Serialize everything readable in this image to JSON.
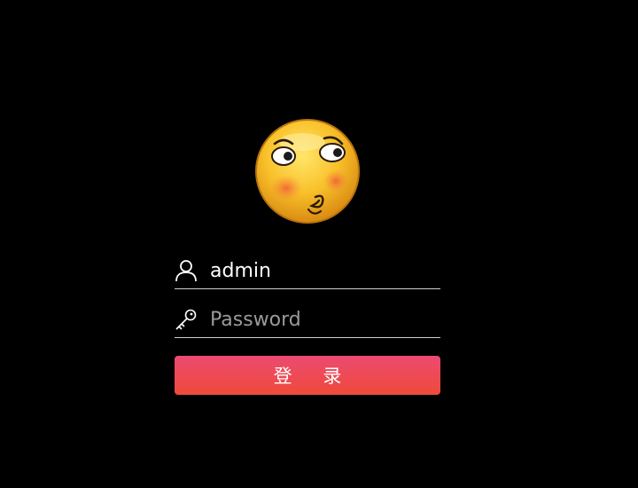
{
  "avatar": {
    "icon": "blushing-emoji-icon"
  },
  "username": {
    "value": "admin",
    "placeholder": "",
    "icon": "user-icon"
  },
  "password": {
    "value": "",
    "placeholder": "Password",
    "icon": "key-icon"
  },
  "login_button": {
    "label": "登 录"
  },
  "colors": {
    "background": "#000000",
    "button_top": "#ec4a72",
    "button_bottom": "#ef4a39",
    "divider": "#cfcfcf",
    "placeholder": "#9a9a9a"
  }
}
